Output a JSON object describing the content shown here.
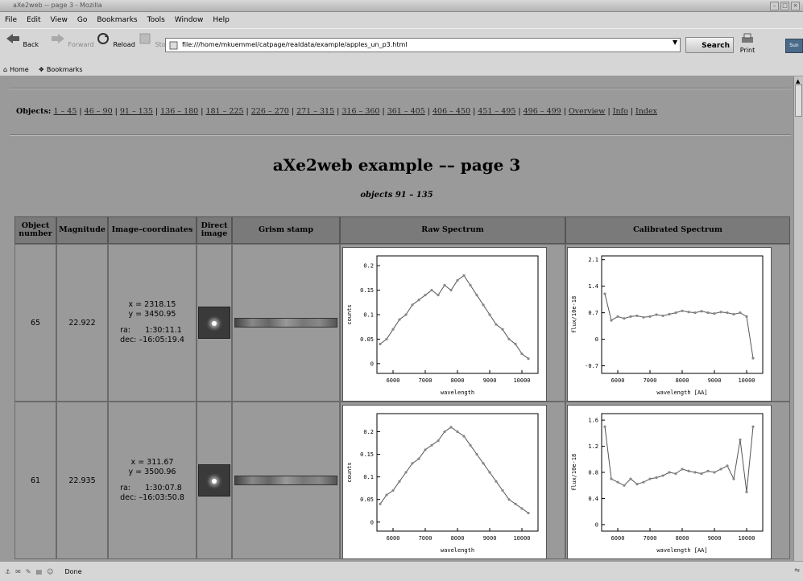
{
  "window": {
    "title": "aXe2web -- page 3 - Mozilla"
  },
  "menu": [
    "File",
    "Edit",
    "View",
    "Go",
    "Bookmarks",
    "Tools",
    "Window",
    "Help"
  ],
  "nav": {
    "back": "Back",
    "forward": "Forward",
    "reload": "Reload",
    "stop": "Stop",
    "url": "file:///home/mkuemmel/catpage/realdata/example/apples_un_p3.html",
    "search": "Search",
    "print": "Print",
    "logo": "Sun"
  },
  "bookmarks": [
    "Home",
    "Bookmarks"
  ],
  "page": {
    "objects_label": "Objects:",
    "object_links": [
      "1 – 45",
      "46 – 90",
      "91 – 135",
      "136 – 180",
      "181 – 225",
      "226 – 270",
      "271 – 315",
      "316 – 360",
      "361 – 405",
      "406 – 450",
      "451 – 495",
      "496 – 499",
      "Overview",
      "Info",
      "Index"
    ],
    "title": "aXe2web example –– page 3",
    "subtitle": "objects 91 – 135",
    "headers": [
      "Object number",
      "Magnitude",
      "Image–coordinates",
      "Direct image",
      "Grism stamp",
      "Raw Spectrum",
      "Calibrated Spectrum"
    ],
    "rows": [
      {
        "object": "65",
        "magnitude": "22.922",
        "x": "x = 2318.15",
        "y": "y = 3450.95",
        "ra_label": "ra:",
        "ra": "1:30:11.1",
        "dec_label": "dec:",
        "dec": "–16:05:19.4"
      },
      {
        "object": "61",
        "magnitude": "22.935",
        "x": "x = 311.67",
        "y": "y = 3500.96",
        "ra_label": "ra:",
        "ra": "1:30:07.8",
        "dec_label": "dec:",
        "dec": "–16:03:50.8"
      }
    ]
  },
  "chart_data": [
    {
      "type": "line",
      "title": "",
      "xlabel": "wavelength",
      "ylabel": "counts",
      "xlim": [
        5500,
        10500
      ],
      "ylim": [
        -0.02,
        0.22
      ],
      "xticks": [
        "6000",
        "7000",
        "8000",
        "9000",
        "10000"
      ],
      "yticks": [
        "0",
        "0.05",
        "0.1",
        "0.15",
        "0.2"
      ],
      "x": [
        5600,
        5800,
        6000,
        6200,
        6400,
        6600,
        6800,
        7000,
        7200,
        7400,
        7600,
        7800,
        8000,
        8200,
        8400,
        8600,
        8800,
        9000,
        9200,
        9400,
        9600,
        9800,
        10000,
        10200
      ],
      "values": [
        0.04,
        0.05,
        0.07,
        0.09,
        0.1,
        0.12,
        0.13,
        0.14,
        0.15,
        0.14,
        0.16,
        0.15,
        0.17,
        0.18,
        0.16,
        0.14,
        0.12,
        0.1,
        0.08,
        0.07,
        0.05,
        0.04,
        0.02,
        0.01
      ]
    },
    {
      "type": "line",
      "title": "",
      "xlabel": "wavelength [AA]",
      "ylabel": "flux/10e-18",
      "xlim": [
        5500,
        10500
      ],
      "ylim": [
        -0.9,
        2.2
      ],
      "xticks": [
        "6000",
        "7000",
        "8000",
        "9000",
        "10000"
      ],
      "yticks": [
        "-0.7",
        "0",
        "0.7",
        "1.4",
        "2.1"
      ],
      "x": [
        5600,
        5800,
        6000,
        6200,
        6400,
        6600,
        6800,
        7000,
        7200,
        7400,
        7600,
        7800,
        8000,
        8200,
        8400,
        8600,
        8800,
        9000,
        9200,
        9400,
        9600,
        9800,
        10000,
        10200
      ],
      "values": [
        1.2,
        0.5,
        0.6,
        0.55,
        0.6,
        0.62,
        0.58,
        0.6,
        0.65,
        0.62,
        0.66,
        0.7,
        0.75,
        0.72,
        0.7,
        0.74,
        0.7,
        0.68,
        0.72,
        0.7,
        0.66,
        0.7,
        0.6,
        -0.5
      ]
    },
    {
      "type": "line",
      "title": "",
      "xlabel": "wavelength",
      "ylabel": "counts",
      "xlim": [
        5500,
        10500
      ],
      "ylim": [
        -0.02,
        0.24
      ],
      "xticks": [
        "6000",
        "7000",
        "8000",
        "9000",
        "10000"
      ],
      "yticks": [
        "0",
        "0.05",
        "0.1",
        "0.15",
        "0.2"
      ],
      "x": [
        5600,
        5800,
        6000,
        6200,
        6400,
        6600,
        6800,
        7000,
        7200,
        7400,
        7600,
        7800,
        8000,
        8200,
        8400,
        8600,
        8800,
        9000,
        9200,
        9400,
        9600,
        9800,
        10000,
        10200
      ],
      "values": [
        0.04,
        0.06,
        0.07,
        0.09,
        0.11,
        0.13,
        0.14,
        0.16,
        0.17,
        0.18,
        0.2,
        0.21,
        0.2,
        0.19,
        0.17,
        0.15,
        0.13,
        0.11,
        0.09,
        0.07,
        0.05,
        0.04,
        0.03,
        0.02
      ]
    },
    {
      "type": "line",
      "title": "",
      "xlabel": "wavelength [AA]",
      "ylabel": "flux/10e-18",
      "xlim": [
        5500,
        10500
      ],
      "ylim": [
        -0.1,
        1.7
      ],
      "xticks": [
        "6000",
        "7000",
        "8000",
        "9000",
        "10000"
      ],
      "yticks": [
        "0",
        "0.4",
        "0.8",
        "1.2",
        "1.6"
      ],
      "x": [
        5600,
        5800,
        6000,
        6200,
        6400,
        6600,
        6800,
        7000,
        7200,
        7400,
        7600,
        7800,
        8000,
        8200,
        8400,
        8600,
        8800,
        9000,
        9200,
        9400,
        9600,
        9800,
        10000,
        10200
      ],
      "values": [
        1.5,
        0.7,
        0.65,
        0.6,
        0.7,
        0.62,
        0.65,
        0.7,
        0.72,
        0.75,
        0.8,
        0.78,
        0.85,
        0.82,
        0.8,
        0.78,
        0.82,
        0.8,
        0.85,
        0.9,
        0.7,
        1.3,
        0.5,
        1.5
      ]
    }
  ],
  "status": {
    "text": "Done"
  }
}
